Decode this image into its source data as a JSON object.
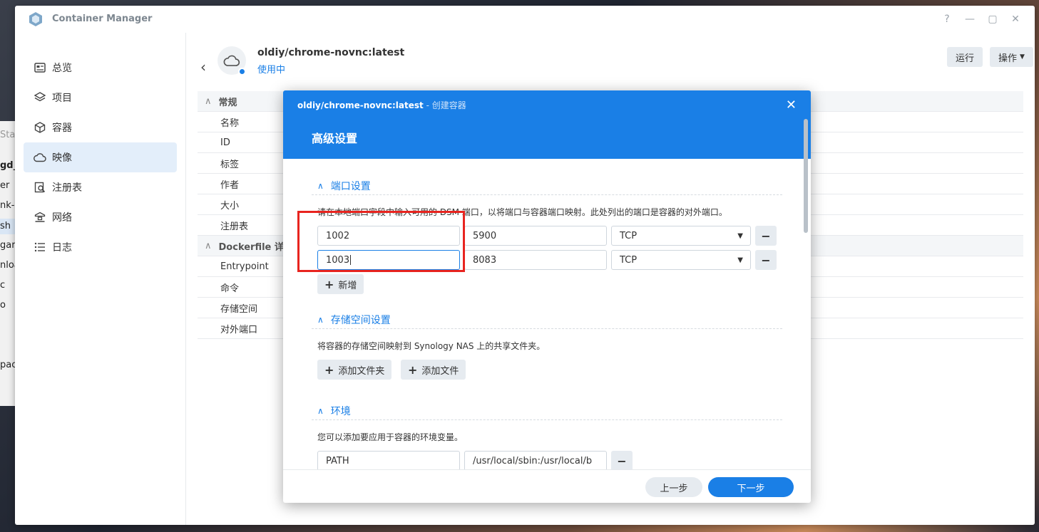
{
  "background_app": {
    "fragments": [
      "Stat",
      "gd_",
      "er",
      "nk-c",
      "sh",
      "garc",
      "nloa",
      "c",
      "o",
      "pac"
    ]
  },
  "window": {
    "title": "Container Manager",
    "controls": [
      "?",
      "—",
      "▢",
      "✕"
    ]
  },
  "sidebar": {
    "items": [
      {
        "label": "总览",
        "icon": "overview-icon"
      },
      {
        "label": "项目",
        "icon": "layers-icon"
      },
      {
        "label": "容器",
        "icon": "container-icon"
      },
      {
        "label": "映像",
        "icon": "cloud-icon",
        "active": true
      },
      {
        "label": "注册表",
        "icon": "registry-search-icon"
      },
      {
        "label": "网络",
        "icon": "network-icon"
      },
      {
        "label": "日志",
        "icon": "log-icon"
      }
    ]
  },
  "image": {
    "name": "oldiy/chrome-novnc:latest",
    "status": "使用中",
    "run_label": "运行",
    "action_label": "操作"
  },
  "details": {
    "general_header": "常规",
    "general_rows": [
      "名称",
      "ID",
      "标签",
      "作者",
      "大小",
      "注册表"
    ],
    "dockerfile_header": "Dockerfile 详细",
    "dockerfile_rows": [
      "Entrypoint",
      "命令",
      "存储空间",
      "对外端口"
    ]
  },
  "modal": {
    "subtitle_name": "oldiy/chrome-novnc:latest",
    "subtitle_suffix": " - 创建容器",
    "title": "高级设置",
    "port_section": {
      "title": "端口设置",
      "description": "请在本地端口字段中输入可用的 DSM 端口，以将端口与容器端口映射。此处列出的端口是容器的对外端口。",
      "rows": [
        {
          "local": "1002",
          "container": "5900",
          "protocol": "TCP"
        },
        {
          "local": "1003",
          "container": "8083",
          "protocol": "TCP"
        }
      ],
      "add_label": "新增"
    },
    "storage_section": {
      "title": "存储空间设置",
      "description": "将容器的存储空间映射到 Synology NAS 上的共享文件夹。",
      "add_folder_label": "添加文件夹",
      "add_file_label": "添加文件"
    },
    "env_section": {
      "title": "环境",
      "description": "您可以添加要应用于容器的环境变量。",
      "rows": [
        {
          "key": "PATH",
          "value": "/usr/local/sbin:/usr/local/b"
        }
      ]
    },
    "prev_label": "上一步",
    "next_label": "下一步"
  },
  "colors": {
    "accent": "#1a7fe6",
    "highlight": "#e8241f"
  }
}
